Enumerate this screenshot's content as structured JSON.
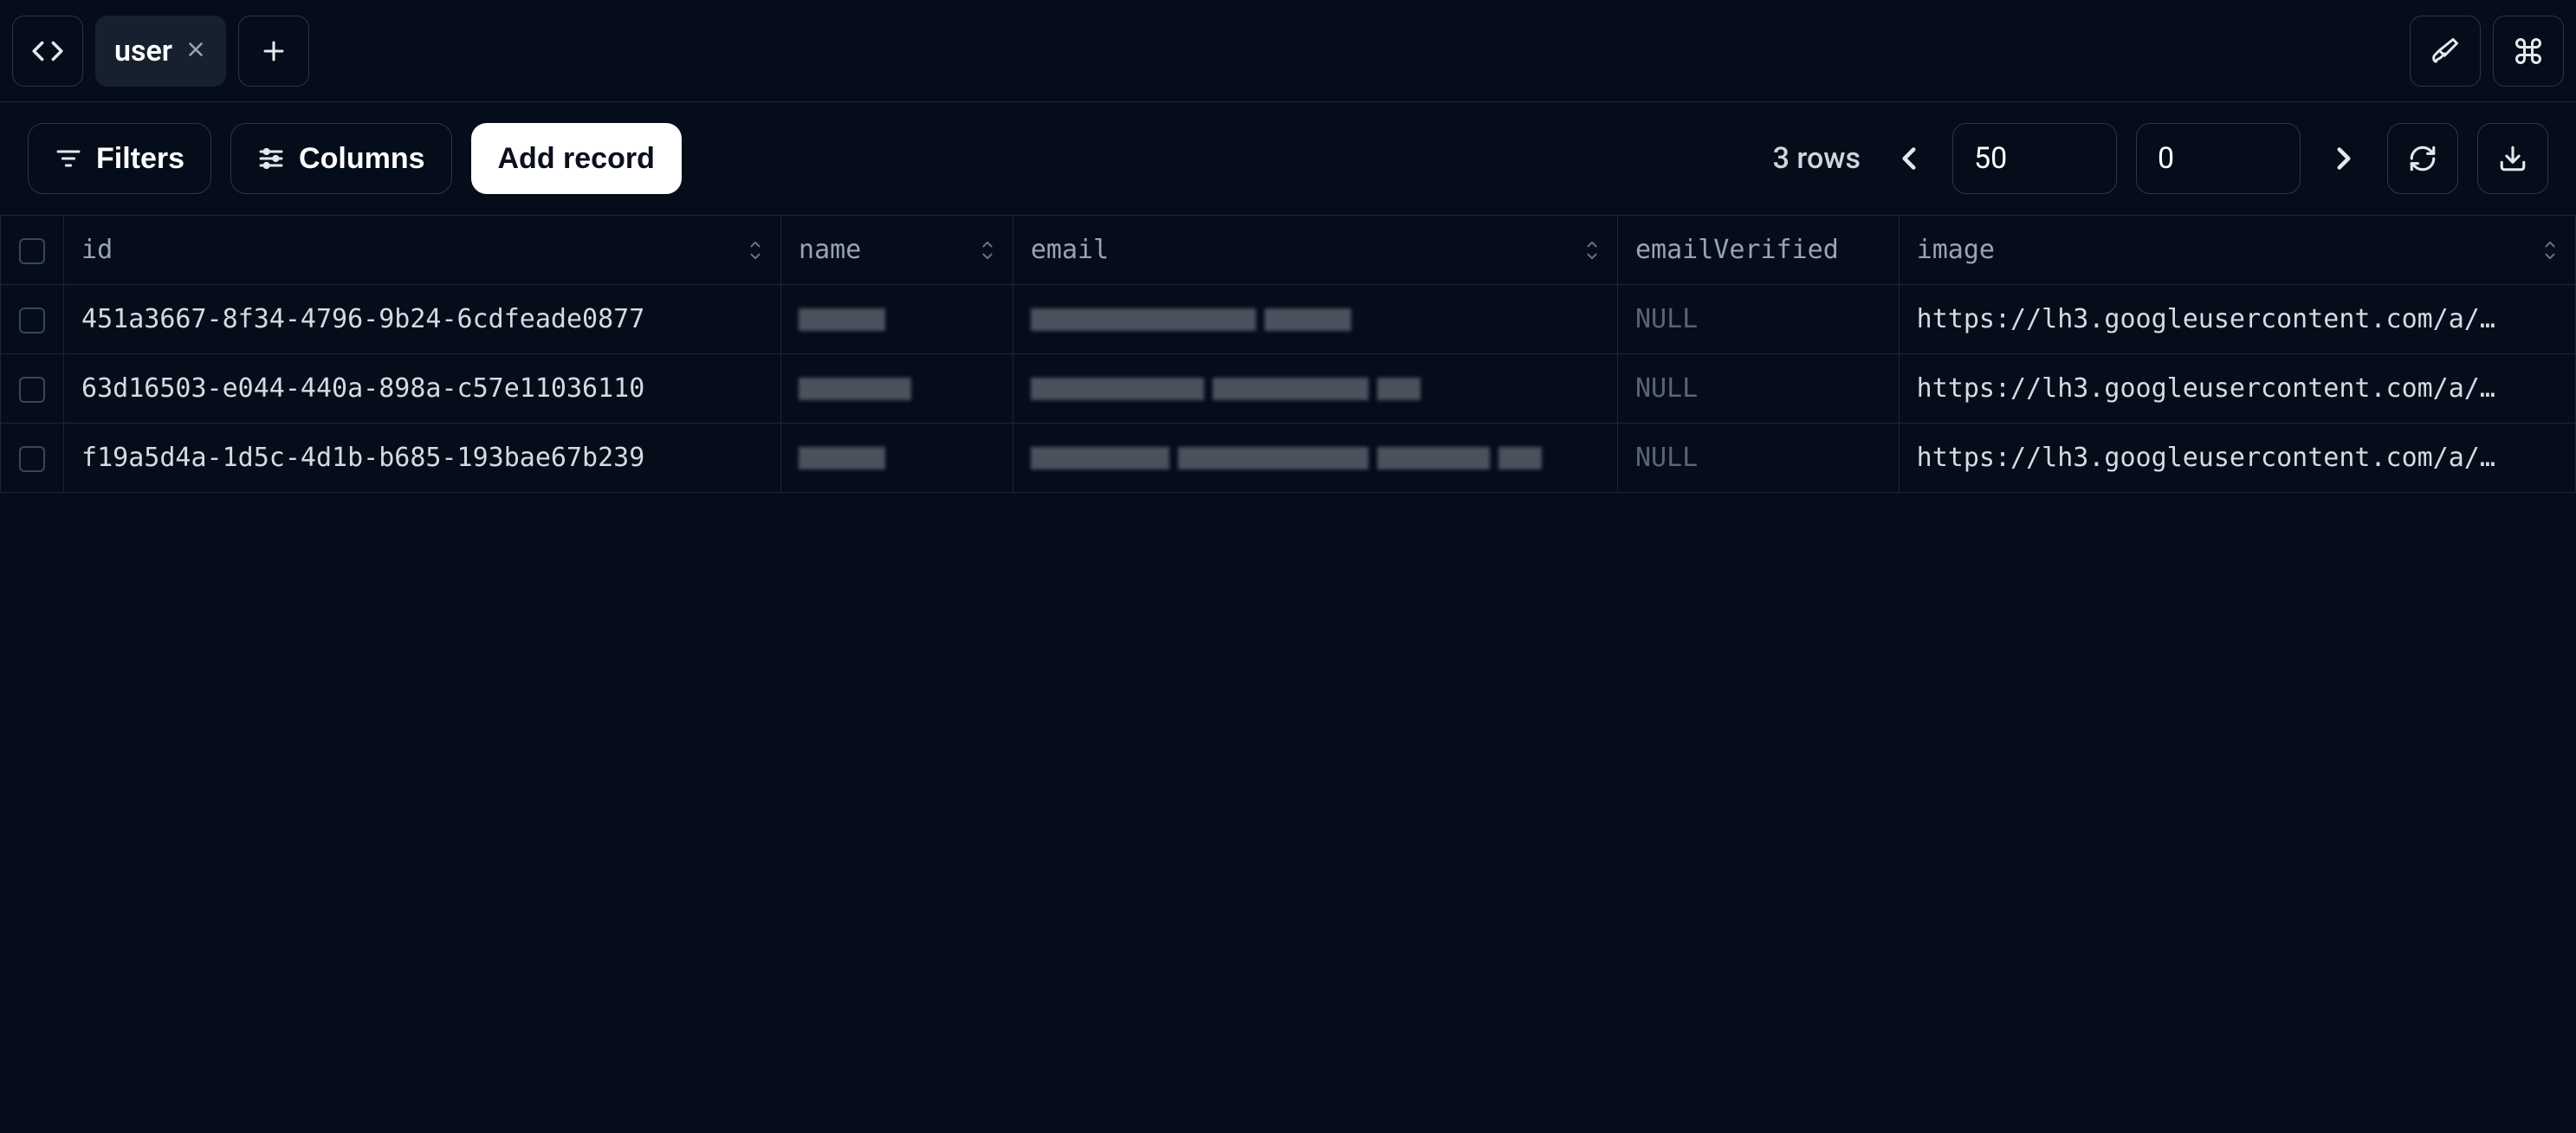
{
  "tabs": {
    "active_label": "user"
  },
  "toolbar": {
    "filters_label": "Filters",
    "columns_label": "Columns",
    "add_record_label": "Add record",
    "rows_text": "3 rows",
    "page_size": "50",
    "offset": "0"
  },
  "columns": {
    "id": "id",
    "name": "name",
    "email": "email",
    "emailVerified": "emailVerified",
    "image": "image"
  },
  "rows": [
    {
      "id": "451a3667-8f34-4796-9b24-6cdfeade0877",
      "emailVerified": "NULL",
      "image": "https://lh3.googleusercontent.com/a/…"
    },
    {
      "id": "63d16503-e044-440a-898a-c57e11036110",
      "emailVerified": "NULL",
      "image": "https://lh3.googleusercontent.com/a/…"
    },
    {
      "id": "f19a5d4a-1d5c-4d1b-b685-193bae67b239",
      "emailVerified": "NULL",
      "image": "https://lh3.googleusercontent.com/a/…"
    }
  ]
}
